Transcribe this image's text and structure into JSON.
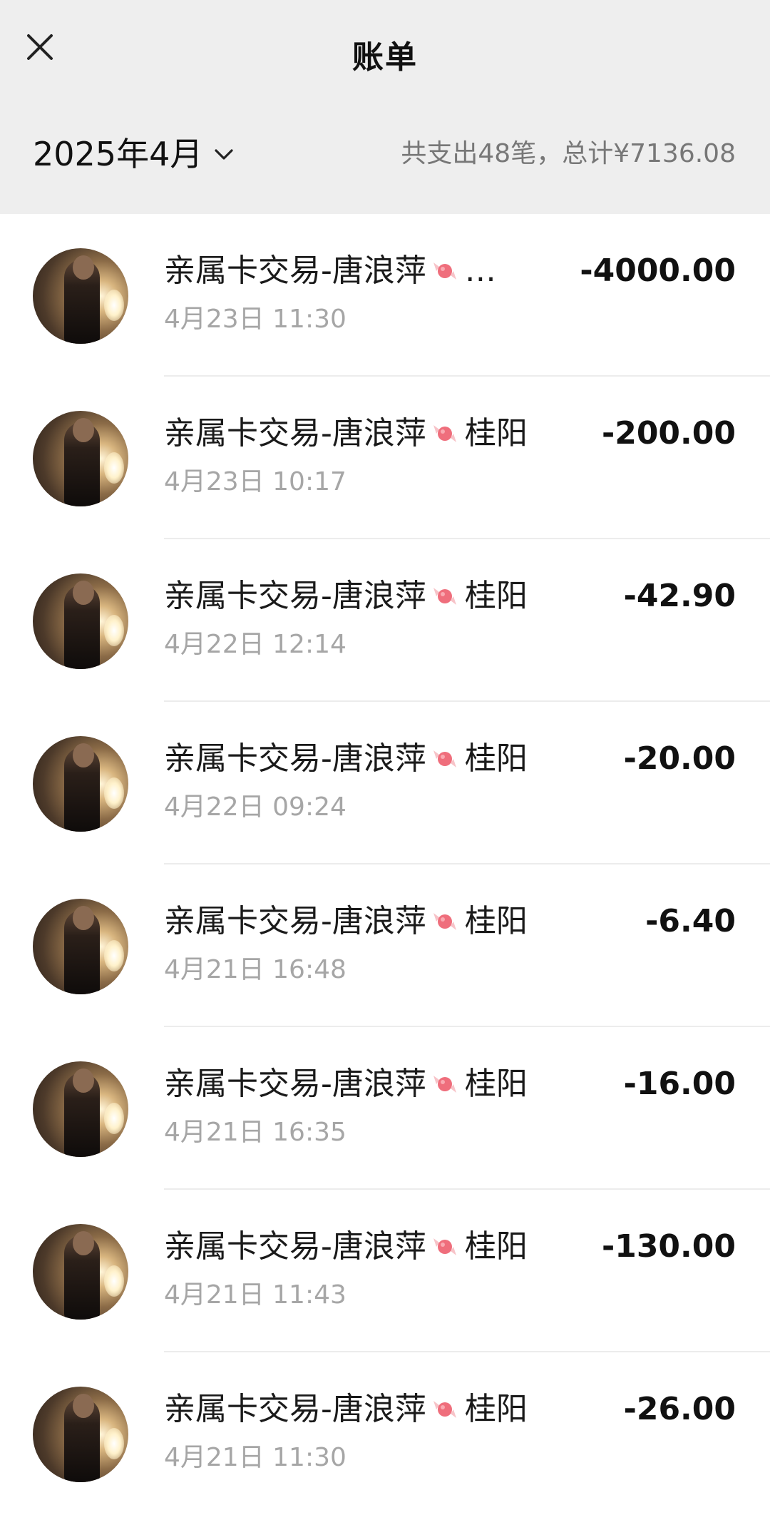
{
  "header": {
    "title": "账单",
    "month": "2025年4月",
    "summary": "共支出48笔，总计¥7136.08"
  },
  "icons": {
    "close": "close-icon",
    "month_dropdown": "chevron-down-icon",
    "merchant_badge": "candy-icon"
  },
  "colors": {
    "header_bg": "#eeeeee",
    "candy": "#ef6e7c"
  },
  "transactions": [
    {
      "name": "亲属卡交易-唐浪萍",
      "suffix": "…",
      "time": "4月23日 11:30",
      "amount": "-4000.00"
    },
    {
      "name": "亲属卡交易-唐浪萍",
      "suffix": "桂阳",
      "time": "4月23日 10:17",
      "amount": "-200.00"
    },
    {
      "name": "亲属卡交易-唐浪萍",
      "suffix": "桂阳",
      "time": "4月22日 12:14",
      "amount": "-42.90"
    },
    {
      "name": "亲属卡交易-唐浪萍",
      "suffix": "桂阳",
      "time": "4月22日 09:24",
      "amount": "-20.00"
    },
    {
      "name": "亲属卡交易-唐浪萍",
      "suffix": "桂阳",
      "time": "4月21日 16:48",
      "amount": "-6.40"
    },
    {
      "name": "亲属卡交易-唐浪萍",
      "suffix": "桂阳",
      "time": "4月21日 16:35",
      "amount": "-16.00"
    },
    {
      "name": "亲属卡交易-唐浪萍",
      "suffix": "桂阳",
      "time": "4月21日 11:43",
      "amount": "-130.00"
    },
    {
      "name": "亲属卡交易-唐浪萍",
      "suffix": "桂阳",
      "time": "4月21日 11:30",
      "amount": "-26.00"
    }
  ]
}
